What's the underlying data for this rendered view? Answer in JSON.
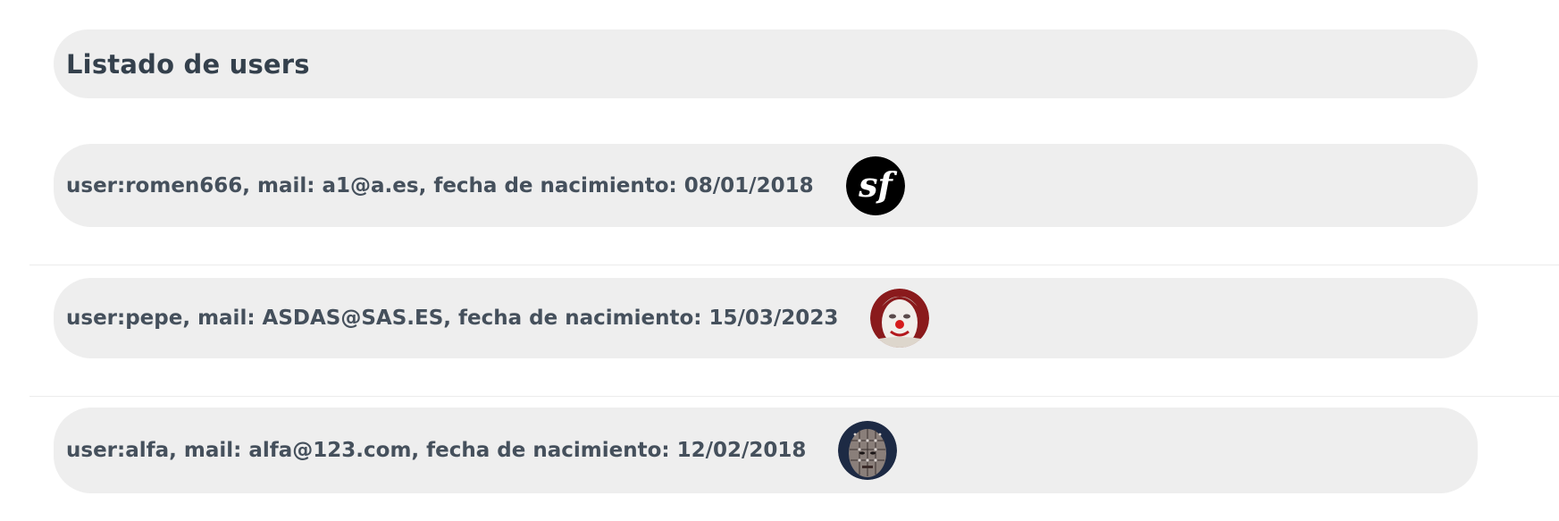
{
  "header": {
    "title": "Listado de users"
  },
  "users": [
    {
      "text": "user:romen666, mail: a1@a.es, fecha de nacimiento: 08/01/2018",
      "avatar": "symfony-logo-icon"
    },
    {
      "text": "user:pepe, mail: ASDAS@SAS.ES, fecha de nacimiento: 15/03/2023",
      "avatar": "clown-avatar-icon"
    },
    {
      "text": "user:alfa, mail: alfa@123.com, fecha de nacimiento: 12/02/2018",
      "avatar": "pinhead-avatar-icon"
    }
  ],
  "colors": {
    "panel_bg": "#eeeeee",
    "text": "#45505c",
    "title_text": "#34404c"
  }
}
